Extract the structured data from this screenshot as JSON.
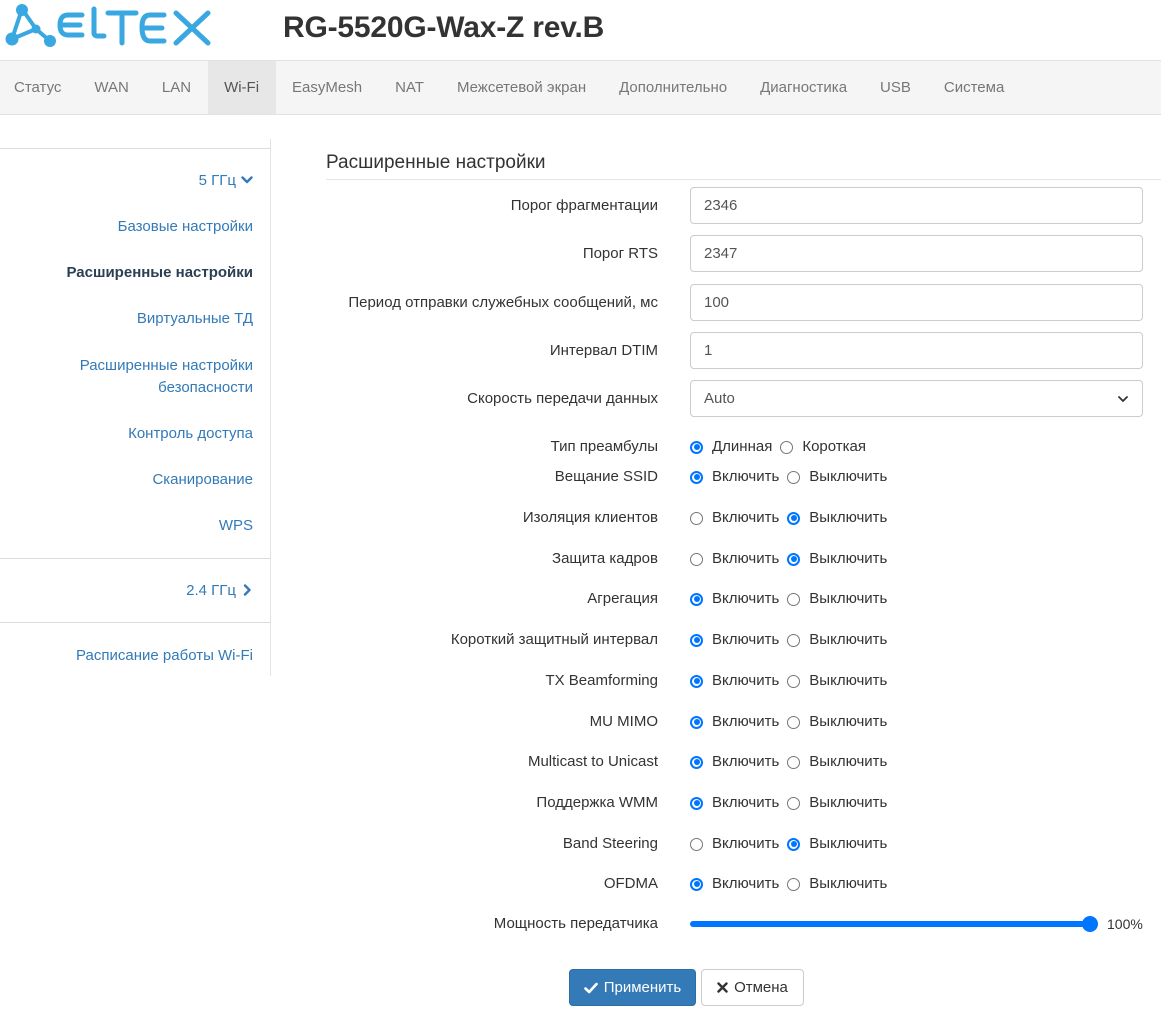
{
  "header": {
    "logo_text": "ELTEX",
    "model": "RG-5520G-Wax-Z rev.B"
  },
  "nav": {
    "active": "Wi-Fi",
    "items": [
      "Статус",
      "WAN",
      "LAN",
      "Wi-Fi",
      "EasyMesh",
      "NAT",
      "Межсетевой экран",
      "Дополнительно",
      "Диагностика",
      "USB",
      "Система"
    ]
  },
  "sidebar": {
    "group_5ghz": "5 ГГц",
    "items": [
      "Базовые настройки",
      "Расширенные настройки",
      "Виртуальные ТД",
      "Расширенные настройки безопасности",
      "Контроль доступа",
      "Сканирование",
      "WPS"
    ],
    "active_item": "Расширенные настройки",
    "group_24ghz": "2.4 ГГц",
    "schedule": "Расписание работы Wi-Fi"
  },
  "main": {
    "title": "Расширенные настройки",
    "fragmentation": {
      "label": "Порог фрагментации",
      "value": "2346"
    },
    "rts": {
      "label": "Порог RTS",
      "value": "2347"
    },
    "beacon": {
      "label": "Период отправки служебных сообщений, мс",
      "value": "100"
    },
    "dtim": {
      "label": "Интервал DTIM",
      "value": "1"
    },
    "rate": {
      "label": "Скорость передачи данных",
      "value": "Auto"
    },
    "preamble": {
      "label": "Тип преамбулы",
      "option_a": "Длинная",
      "option_b": "Короткая",
      "selected": "Длинная"
    },
    "options": {
      "on_label": "Включить",
      "off_label": "Выключить",
      "rows": [
        {
          "label": "Вещание SSID",
          "selected": "on"
        },
        {
          "label": "Изоляция клиентов",
          "selected": "off"
        },
        {
          "label": "Защита кадров",
          "selected": "off"
        },
        {
          "label": "Агрегация",
          "selected": "on"
        },
        {
          "label": "Короткий защитный интервал",
          "selected": "on"
        },
        {
          "label": "TX Beamforming",
          "selected": "on"
        },
        {
          "label": "MU MIMO",
          "selected": "on"
        },
        {
          "label": "Multicast to Unicast",
          "selected": "on"
        },
        {
          "label": "Поддержка WMM",
          "selected": "on"
        },
        {
          "label": "Band Steering",
          "selected": "off"
        },
        {
          "label": "OFDMA",
          "selected": "on"
        }
      ]
    },
    "tx_power": {
      "label": "Мощность передатчика",
      "value_percent": 100,
      "value_text": "100%"
    }
  },
  "buttons": {
    "apply": "Применить",
    "cancel": "Отмена"
  },
  "colors": {
    "accent": "#337ab7",
    "radio": "#0075ff",
    "nav_bg": "#f5f5f5",
    "logo": "#3aa8e0"
  }
}
